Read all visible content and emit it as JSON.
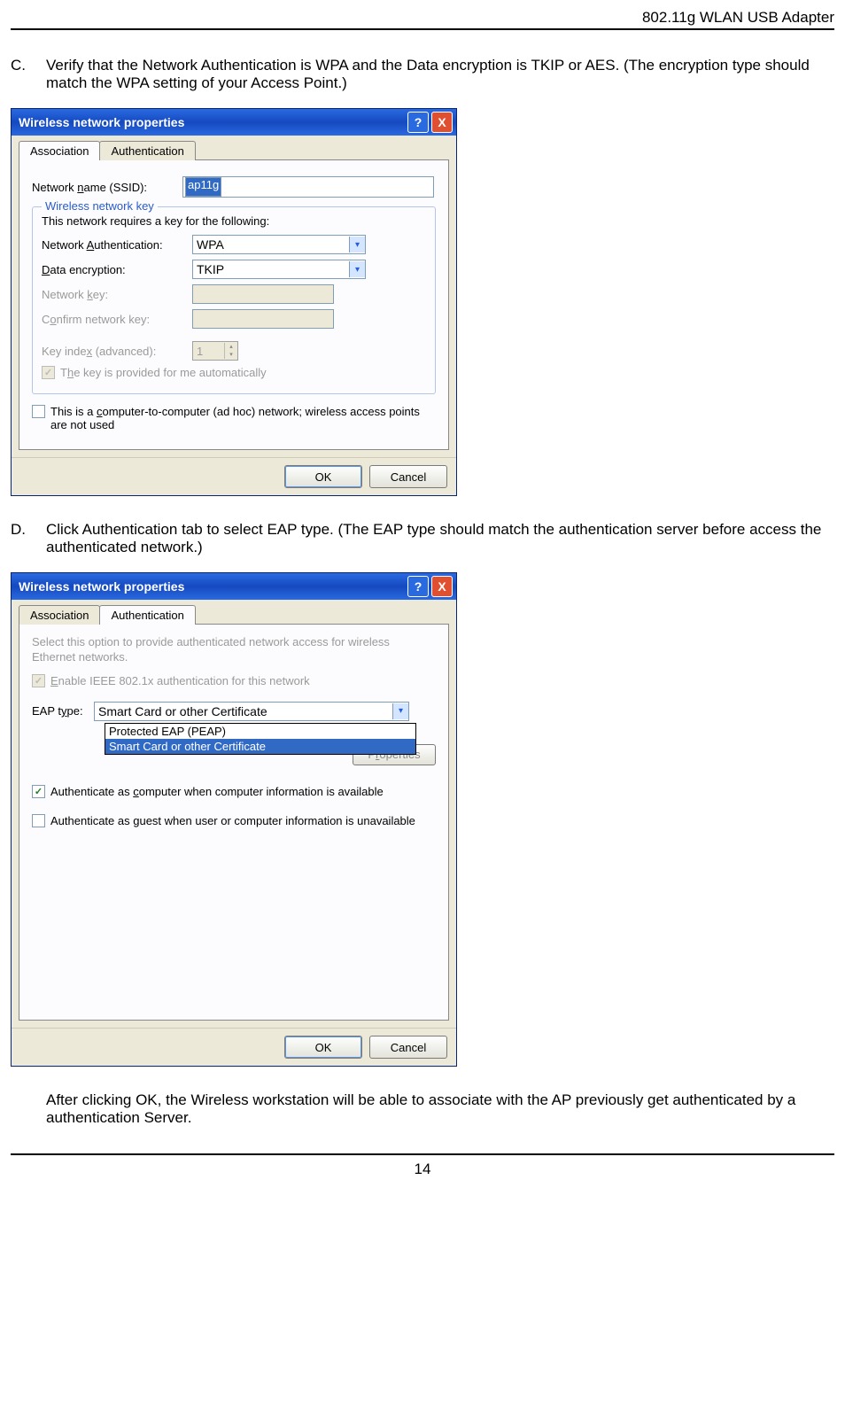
{
  "header": "802.11g WLAN USB Adapter",
  "stepC": {
    "letter": "C.",
    "text": "Verify that the Network Authentication is WPA and the Data encryption is TKIP or AES. (The encryption type should match the WPA setting of your Access Point.)"
  },
  "stepD": {
    "letter": "D.",
    "text": "Click Authentication tab to select EAP type. (The EAP type should match the authentication server before access the authenticated network.)"
  },
  "afterText": "After clicking OK, the Wireless workstation will be able to associate with the AP previously get authenticated by a authentication Server.",
  "pageNum": "14",
  "dialog1": {
    "title": "Wireless network properties",
    "tab_assoc": "Association",
    "tab_auth": "Authentication",
    "ssid_label": "Network name (SSID):",
    "ssid_value": "ap11g",
    "fieldset_legend": "Wireless network key",
    "req_text": "This network requires a key for the following:",
    "auth_label": "Network Authentication:",
    "auth_value": "WPA",
    "enc_label": "Data encryption:",
    "enc_value": "TKIP",
    "key_label": "Network key:",
    "confirm_label": "Confirm network key:",
    "index_label": "Key index (advanced):",
    "index_value": "1",
    "autokey": "The key is provided for me automatically",
    "adhoc": "This is a computer-to-computer (ad hoc) network; wireless access points are not used",
    "ok": "OK",
    "cancel": "Cancel"
  },
  "dialog2": {
    "title": "Wireless network properties",
    "tab_assoc": "Association",
    "tab_auth": "Authentication",
    "desc": "Select this option to provide authenticated network access for wireless Ethernet networks.",
    "enable8021x": "Enable IEEE 802.1x authentication for this network",
    "eap_label": "EAP type:",
    "eap_value": "Smart Card or other Certificate",
    "dd_item1": "Protected EAP (PEAP)",
    "dd_item2": "Smart Card or other Certificate",
    "props_btn": "Properties",
    "chk_comp": "Authenticate as computer when computer information is available",
    "chk_guest": "Authenticate as guest when user or computer information is unavailable",
    "ok": "OK",
    "cancel": "Cancel"
  }
}
